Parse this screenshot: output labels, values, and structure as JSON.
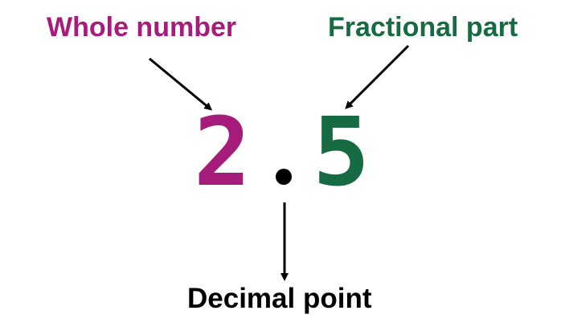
{
  "labels": {
    "whole_number": "Whole number",
    "fractional_part": "Fractional part",
    "decimal_point": "Decimal point"
  },
  "number": {
    "whole": "2",
    "fraction": "5"
  },
  "colors": {
    "whole": "#a51c7a",
    "fraction": "#176b43",
    "text": "#000000",
    "arrow": "#000000"
  }
}
